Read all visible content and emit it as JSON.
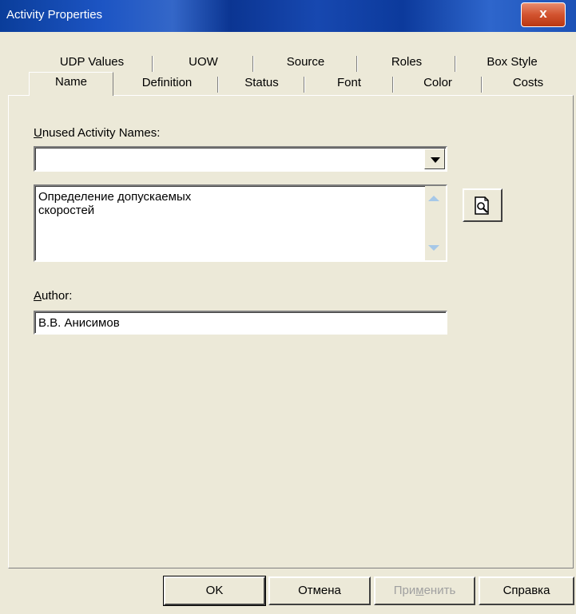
{
  "window": {
    "title": "Activity Properties",
    "close_symbol": "x"
  },
  "tabs_row1": [
    {
      "label": "UDP Values"
    },
    {
      "label": "UOW"
    },
    {
      "label": "Source"
    },
    {
      "label": "Roles"
    },
    {
      "label": "Box Style"
    }
  ],
  "tabs_row2": [
    {
      "label": "Name"
    },
    {
      "label": "Definition"
    },
    {
      "label": "Status"
    },
    {
      "label": "Font"
    },
    {
      "label": "Color"
    },
    {
      "label": "Costs"
    }
  ],
  "active_tab": "Name",
  "unused_names": {
    "label_first": "U",
    "label_rest": "nused Activity Names:",
    "value": ""
  },
  "activity_name": {
    "value": "Определение допускаемых\nскоростей"
  },
  "author": {
    "label_first": "A",
    "label_rest": "uthor:",
    "value": "В.В. Анисимов"
  },
  "buttons": {
    "ok": "OK",
    "cancel": "Отмена",
    "apply_a": "При",
    "apply_u": "м",
    "apply_b": "енить",
    "help": "Справка"
  },
  "icons": {
    "browse": "browse-document-icon",
    "dropdown": "chevron-down-icon",
    "close": "close-icon"
  }
}
